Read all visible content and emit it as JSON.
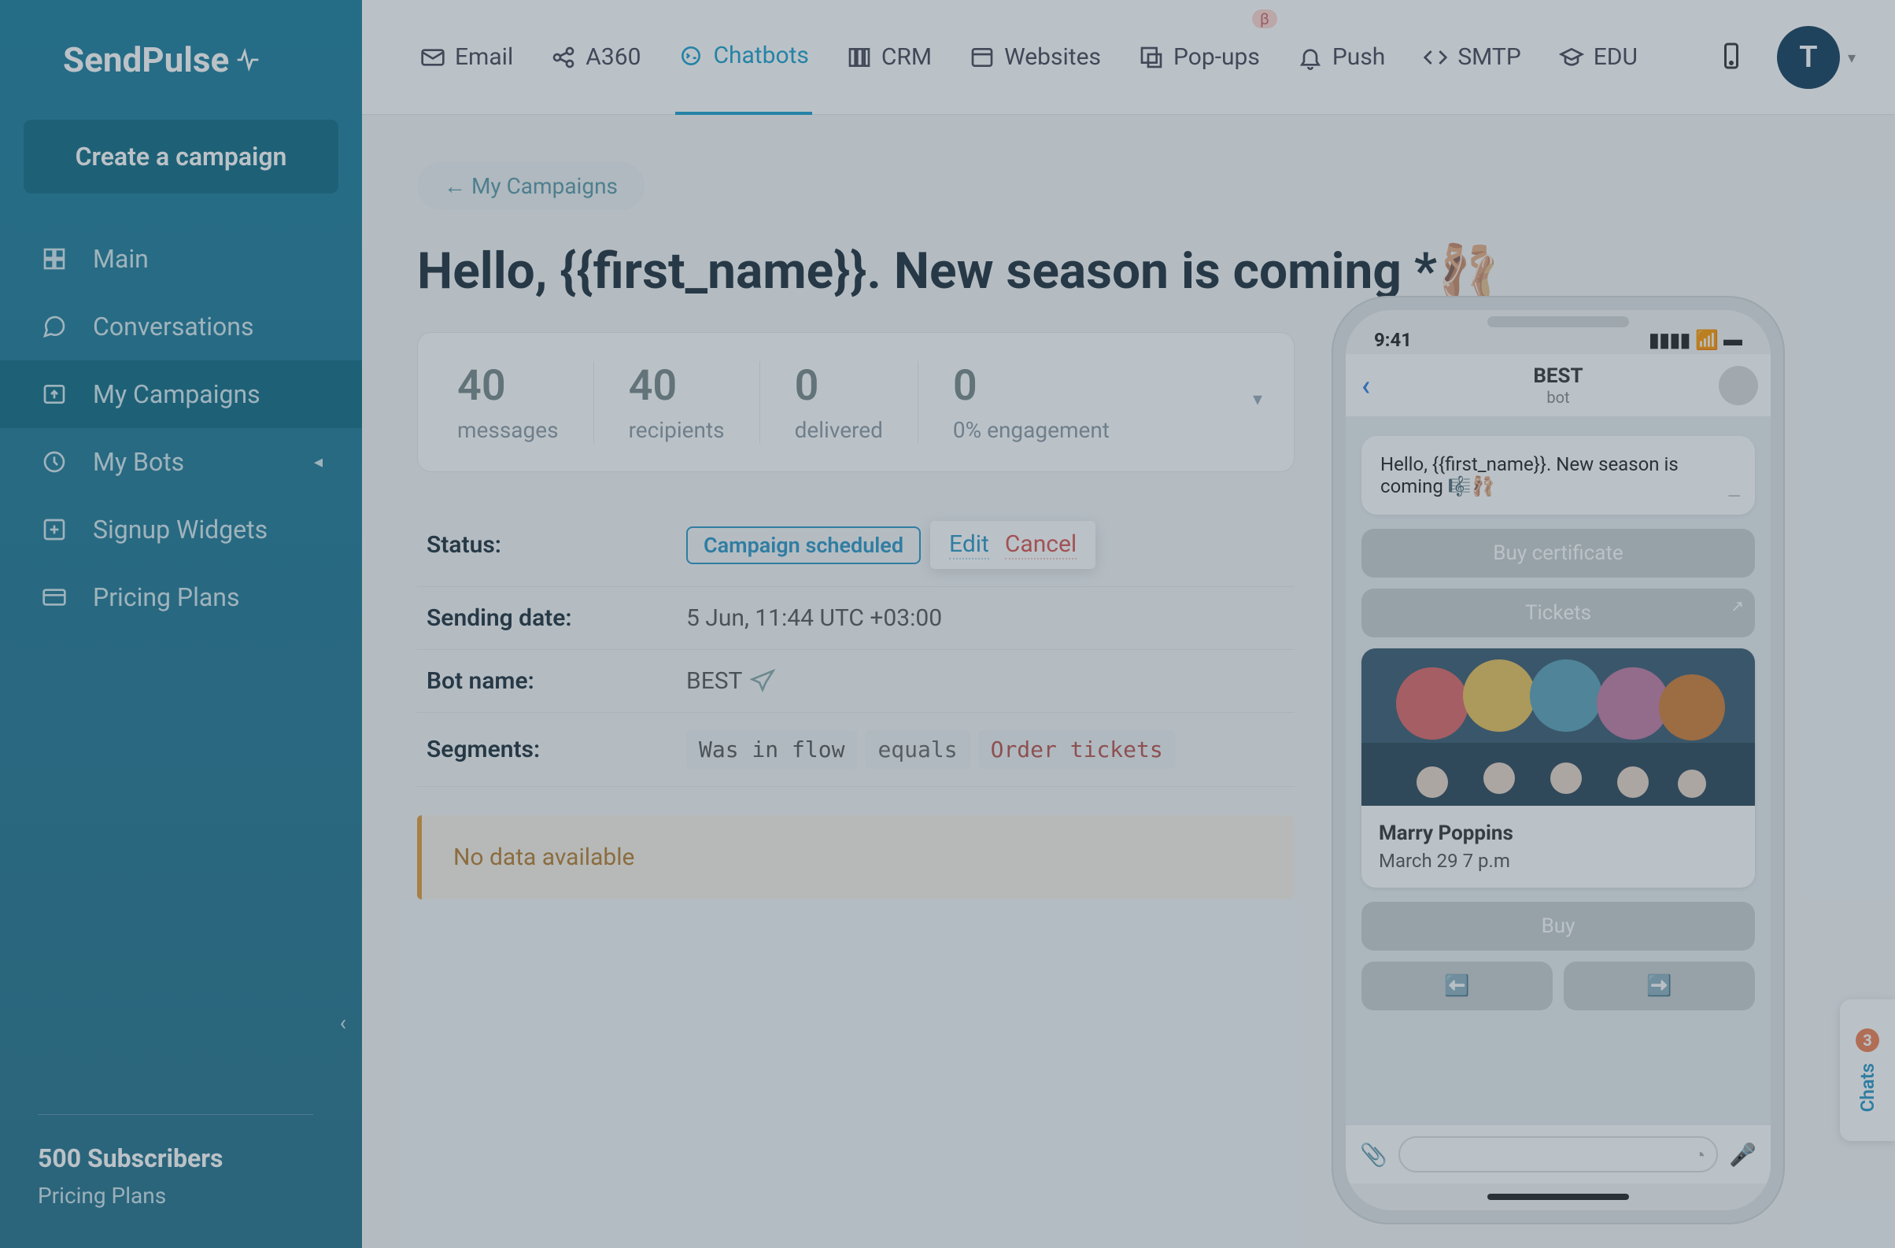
{
  "brand": "SendPulse",
  "sidebar": {
    "create_label": "Create a campaign",
    "items": [
      {
        "label": "Main"
      },
      {
        "label": "Conversations"
      },
      {
        "label": "My Campaigns"
      },
      {
        "label": "My Bots"
      },
      {
        "label": "Signup Widgets"
      },
      {
        "label": "Pricing Plans"
      }
    ],
    "subscribers": "500 Subscribers",
    "plans": "Pricing Plans"
  },
  "topnav": {
    "email": "Email",
    "a360": "A360",
    "chatbots": "Chatbots",
    "crm": "CRM",
    "websites": "Websites",
    "popups": "Pop-ups",
    "popups_badge": "β",
    "push": "Push",
    "smtp": "SMTP",
    "edu": "EDU",
    "avatar_initial": "T"
  },
  "breadcrumb": "← My Campaigns",
  "page_title": "Hello, {{first_name}}. New season is coming *🩰",
  "stats": {
    "messages_val": "40",
    "messages_lbl": "messages",
    "recipients_val": "40",
    "recipients_lbl": "recipients",
    "delivered_val": "0",
    "delivered_lbl": "delivered",
    "engagement_val": "0",
    "engagement_lbl": "0% engagement"
  },
  "details": {
    "status_k": "Status:",
    "status_pill": "Campaign scheduled",
    "edit": "Edit",
    "cancel": "Cancel",
    "sending_date_k": "Sending date:",
    "sending_date_v": "5 Jun, 11:44 UTC +03:00",
    "bot_name_k": "Bot name:",
    "bot_name_v": "BEST",
    "segments_k": "Segments:",
    "seg_chip1": "Was in flow",
    "seg_chip2": "equals",
    "seg_chip3": "Order tickets"
  },
  "no_data": "No data available",
  "phone": {
    "time": "9:41",
    "header_name": "BEST",
    "header_sub": "bot",
    "msg": "Hello, {{first_name}}. New season is coming 🎼🩰",
    "btn_cert": "Buy certificate",
    "btn_tickets": "Tickets",
    "card_title": "Marry Poppins",
    "card_date": "March 29 7 p.m",
    "btn_buy": "Buy",
    "arrow_left": "⬅️",
    "arrow_right": "➡️"
  },
  "chats_tab": {
    "count": "3",
    "label": "Chats"
  }
}
